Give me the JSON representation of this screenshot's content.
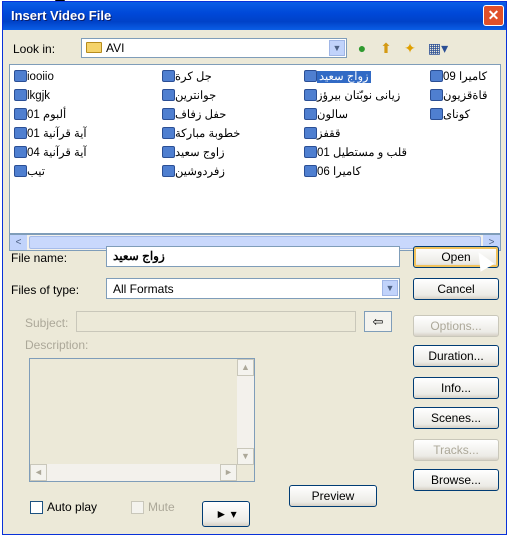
{
  "window": {
    "title": "Insert Video File",
    "close_glyph": "✕"
  },
  "lookin": {
    "label": "Look in:",
    "value": "AVI",
    "arrow": "▼",
    "back_glyph": "●",
    "up_glyph": "⬆",
    "newfolder_glyph": "✦",
    "views_glyph": "▦▾"
  },
  "files": [
    {
      "label": "iooiio",
      "dir": "ltr",
      "selected": false
    },
    {
      "label": "lkgjk",
      "dir": "ltr",
      "selected": false
    },
    {
      "label": "ألبوم 01",
      "dir": "rtl",
      "selected": false
    },
    {
      "label": "آية قرآنية 01",
      "dir": "rtl",
      "selected": false
    },
    {
      "label": "آية قرآنية 04",
      "dir": "rtl",
      "selected": false
    },
    {
      "label": "تيب",
      "dir": "rtl",
      "selected": false
    },
    {
      "label": "جل كرة",
      "dir": "rtl",
      "selected": false
    },
    {
      "label": "جوانترين",
      "dir": "rtl",
      "selected": false
    },
    {
      "label": "حفل زفاف",
      "dir": "rtl",
      "selected": false
    },
    {
      "label": "خطوبة مباركة",
      "dir": "rtl",
      "selected": false
    },
    {
      "label": "زاوج سعيد",
      "dir": "rtl",
      "selected": false
    },
    {
      "label": "زفردوشين",
      "dir": "rtl",
      "selected": false
    },
    {
      "label": "زواج سعيد",
      "dir": "rtl",
      "selected": true
    },
    {
      "label": "زيانى نوبّتان بيرؤز",
      "dir": "rtl",
      "selected": false
    },
    {
      "label": "سالون",
      "dir": "rtl",
      "selected": false
    },
    {
      "label": "ققفز",
      "dir": "rtl",
      "selected": false
    },
    {
      "label": "قلب و مستطيل 01",
      "dir": "rtl",
      "selected": false
    },
    {
      "label": "كاميرا 06",
      "dir": "rtl",
      "selected": false
    },
    {
      "label": "كاميرا 09",
      "dir": "rtl",
      "selected": false
    },
    {
      "label": "قاةقزيون",
      "dir": "rtl",
      "selected": false
    },
    {
      "label": "كوناى",
      "dir": "rtl",
      "selected": false
    }
  ],
  "hscroll": {
    "left": "<",
    "right": ">",
    "grip": "|||"
  },
  "filename": {
    "label": "File name:",
    "value": "زواج سعيد"
  },
  "filetype": {
    "label": "Files of type:",
    "value": "All Formats",
    "arrow": "▼"
  },
  "subject": {
    "label": "Subject:",
    "value": "",
    "arrow_btn": "⇦"
  },
  "description": {
    "label": "Description:",
    "value": ""
  },
  "buttons": {
    "open": "Open",
    "cancel": "Cancel",
    "options": "Options...",
    "duration": "Duration...",
    "info": "Info...",
    "scenes": "Scenes...",
    "tracks": "Tracks...",
    "browse": "Browse..."
  },
  "preview": "Preview",
  "autoplay": {
    "label": "Auto play",
    "checked": false
  },
  "mute": {
    "label": "Mute",
    "checked": false
  },
  "play": "► ▾",
  "scroll_glyphs": {
    "up": "▲",
    "down": "▼",
    "left": "◄",
    "right": "►"
  }
}
